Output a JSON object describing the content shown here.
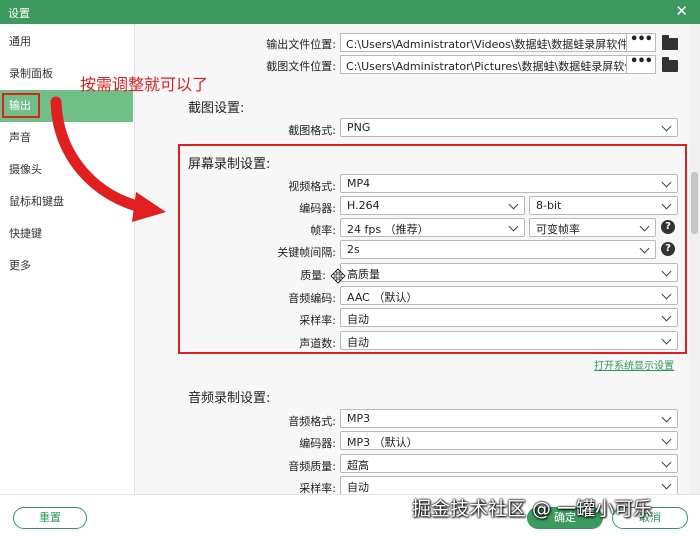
{
  "window": {
    "title": "设置",
    "close_glyph": "✕"
  },
  "sidebar": {
    "items": [
      {
        "label": "通用"
      },
      {
        "label": "录制面板"
      },
      {
        "label": "输出"
      },
      {
        "label": "声音"
      },
      {
        "label": "摄像头"
      },
      {
        "label": "鼠标和键盘"
      },
      {
        "label": "快捷键"
      },
      {
        "label": "更多"
      }
    ],
    "active_index": 2
  },
  "output_paths": {
    "output_label": "输出文件位置:",
    "output_value": "C:\\Users\\Administrator\\Videos\\数据蛙\\数据蛙录屏软件",
    "screenshot_label": "截图文件位置:",
    "screenshot_value": "C:\\Users\\Administrator\\Pictures\\数据蛙\\数据蛙录屏软件",
    "browse_glyph": "•••"
  },
  "screenshot_settings": {
    "title": "截图设置:",
    "format_label": "截图格式:",
    "format_value": "PNG"
  },
  "screen_settings": {
    "title": "屏幕录制设置:",
    "video_format_label": "视频格式:",
    "video_format_value": "MP4",
    "encoder_label": "编码器:",
    "encoder_value": "H.264",
    "bitdepth_value": "8-bit",
    "framerate_label": "帧率:",
    "framerate_value": "24 fps （推荐）",
    "framerate_mode_value": "可变帧率",
    "keyframe_label": "关键帧间隔:",
    "keyframe_value": "2s",
    "quality_label": "质量:",
    "quality_value": "高质量",
    "audio_codec_label": "音频编码:",
    "audio_codec_value": "AAC （默认）",
    "samplerate_label": "采样率:",
    "samplerate_value": "自动",
    "channels_label": "声道数:",
    "channels_value": "自动",
    "help_glyph": "?"
  },
  "display_settings_link": "打开系统显示设置",
  "audio_settings": {
    "title": "音频录制设置:",
    "format_label": "音频格式:",
    "format_value": "MP3",
    "encoder_label": "编码器:",
    "encoder_value": "MP3 （默认）",
    "quality_label": "音频质量:",
    "quality_value": "超高",
    "samplerate_label": "采样率:",
    "samplerate_value": "自动"
  },
  "annotation": {
    "text": "按需调整就可以了",
    "color": "#e02020"
  },
  "footer": {
    "reset_label": "重置",
    "ok_label": "确定",
    "cancel_label": "取消"
  },
  "watermark": "掘金技术社区 @ 一罐小可乐",
  "colors": {
    "accent": "#3d9a5e",
    "sidebar_active": "#6fbf86",
    "link": "#2e9a5a"
  }
}
